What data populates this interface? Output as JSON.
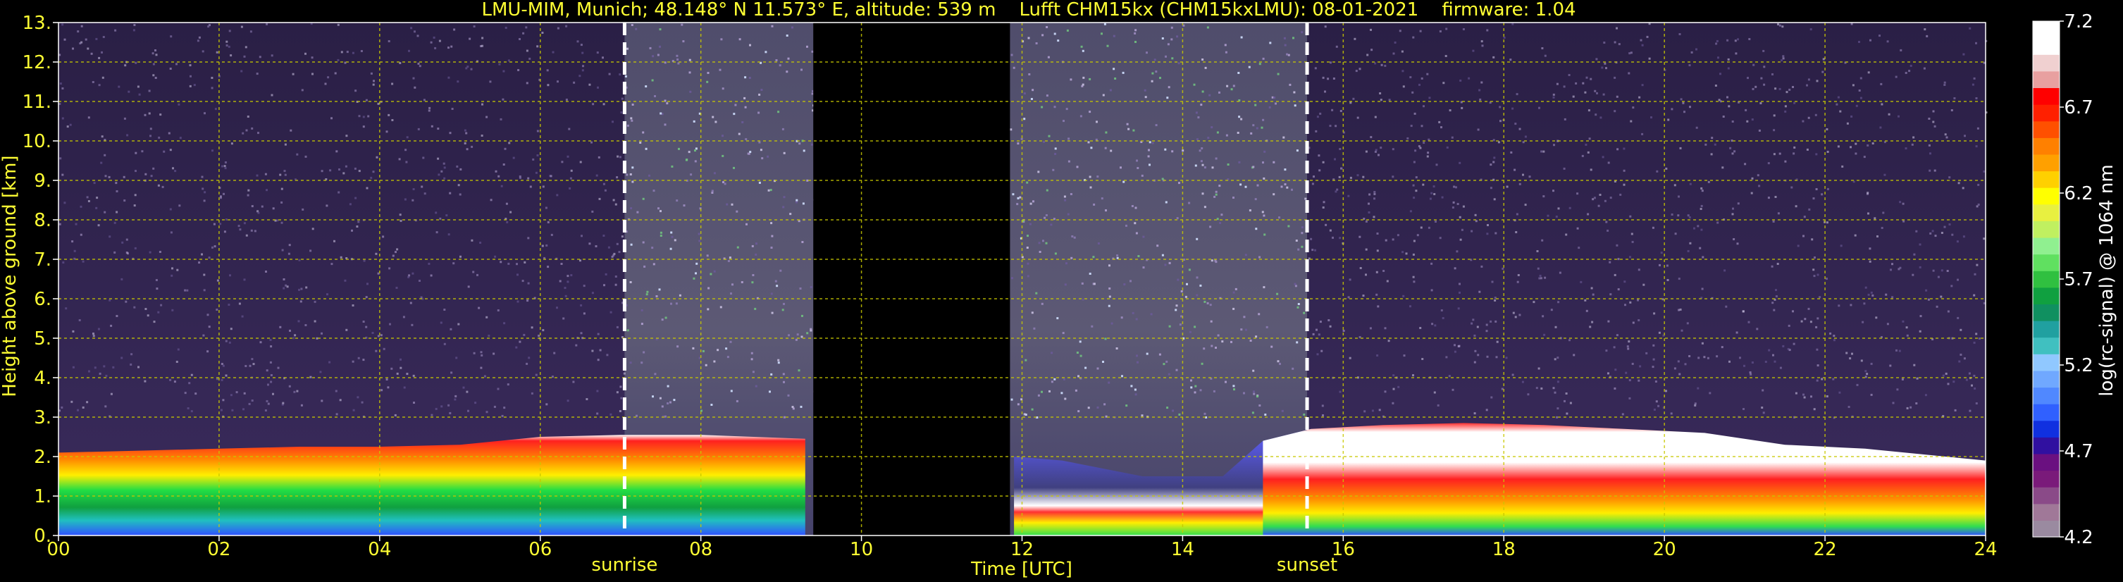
{
  "chart_data": {
    "type": "heatmap",
    "title": "LMU-MIM, Munich; 48.148° N 11.573° E, altitude: 539 m    Lufft CHM15kx (CHM15kxLMU): 08-01-2021    firmware: 1.04",
    "xlabel": "Time [UTC]",
    "ylabel": "Height above ground [km]",
    "colorbar_label": "log(rc-signal) @ 1064 nm",
    "xlim": [
      0,
      24
    ],
    "ylim": [
      0,
      13
    ],
    "x_ticks": [
      "00",
      "02",
      "04",
      "06",
      "08",
      "10",
      "12",
      "14",
      "16",
      "18",
      "20",
      "22",
      "24"
    ],
    "y_ticks": [
      "0.",
      "1.",
      "2.",
      "3.",
      "4.",
      "5.",
      "6.",
      "7.",
      "8.",
      "9.",
      "10.",
      "11.",
      "12.",
      "13."
    ],
    "colorbar_ticks": [
      "4.2",
      "4.7",
      "5.2",
      "5.7",
      "6.2",
      "6.7",
      "7.2"
    ],
    "colorbar_range": [
      4.2,
      7.2
    ],
    "grid": true,
    "markers": [
      {
        "label": "sunrise",
        "time": 7.05
      },
      {
        "label": "sunset",
        "time": 15.55
      }
    ],
    "data_gaps": [
      [
        9.4,
        11.85
      ]
    ],
    "boundary_layer_top_km": [
      [
        0.0,
        2.1
      ],
      [
        1.0,
        2.15
      ],
      [
        2.0,
        2.2
      ],
      [
        3.0,
        2.25
      ],
      [
        4.0,
        2.25
      ],
      [
        5.0,
        2.3
      ],
      [
        6.0,
        2.5
      ],
      [
        7.0,
        2.55
      ],
      [
        8.0,
        2.55
      ],
      [
        9.3,
        2.45
      ],
      [
        11.9,
        2.0
      ],
      [
        12.5,
        1.9
      ],
      [
        13.5,
        1.5
      ],
      [
        14.5,
        1.5
      ],
      [
        15.0,
        2.4
      ],
      [
        15.6,
        2.7
      ],
      [
        16.5,
        2.8
      ],
      [
        17.5,
        2.85
      ],
      [
        18.5,
        2.8
      ],
      [
        19.5,
        2.7
      ],
      [
        20.5,
        2.6
      ],
      [
        21.5,
        2.3
      ],
      [
        22.5,
        2.2
      ],
      [
        23.5,
        2.0
      ],
      [
        24.0,
        1.9
      ]
    ]
  },
  "colors": {
    "axis_text": "#ffff33",
    "marker": "#ffffff",
    "grid": "#c8c800"
  }
}
